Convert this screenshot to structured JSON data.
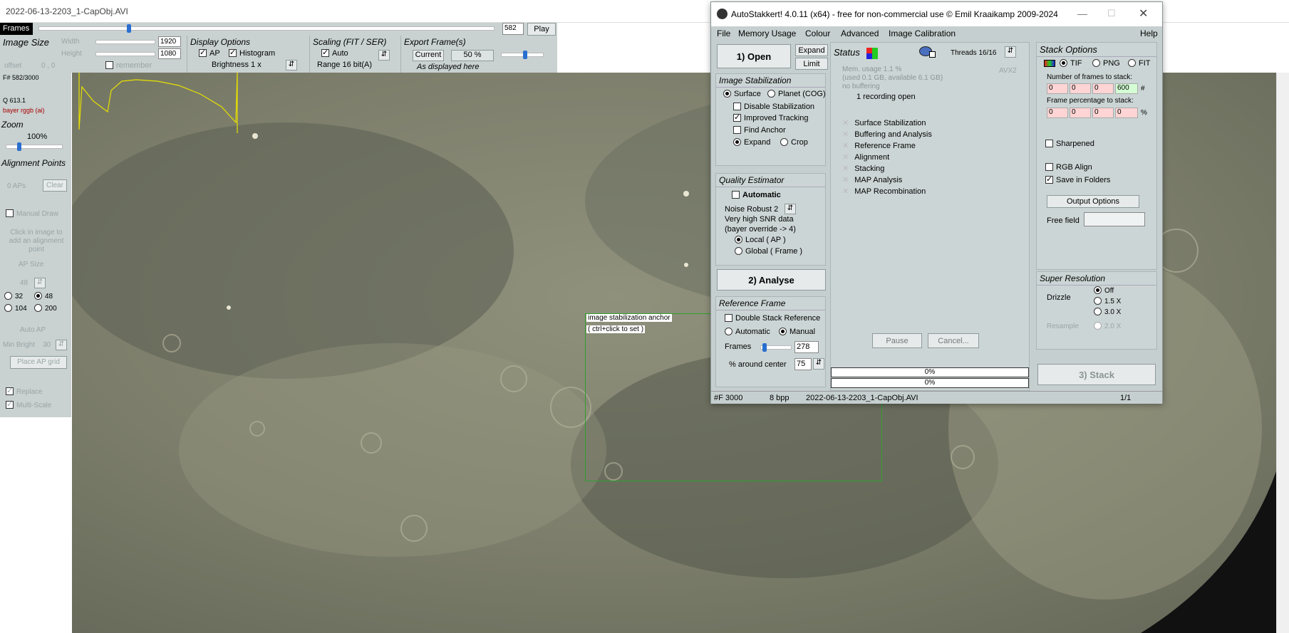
{
  "image_window": {
    "title": "2022-06-13-2203_1-CapObj.AVI",
    "frames_label": "Frames",
    "frame_value": "582",
    "play_label": "Play",
    "frame_position": 0.194
  },
  "image_size": {
    "title": "Image Size",
    "width_label": "Width",
    "width_value": "1920",
    "height_label": "Height",
    "height_value": "1080",
    "offset_label": "offset",
    "offset_value": "0 , 0",
    "remember_label": "remember"
  },
  "display_options": {
    "title": "Display Options",
    "ap_label": "AP",
    "histogram_label": "Histogram",
    "brightness_label": "Brightness 1 x"
  },
  "scaling": {
    "title": "Scaling (FIT / SER)",
    "auto_label": "Auto",
    "range_label": "Range 16 bit(A)"
  },
  "export": {
    "title": "Export Frame(s)",
    "current_label": "Current",
    "percent_value": "50 %",
    "as_displayed": "As displayed here"
  },
  "left_panel": {
    "frame_info": "F# 582/3000",
    "q_info": "Q  613.1",
    "bayer_info": "bayer rggb (ai)",
    "zoom_title": "Zoom",
    "zoom_value": "100%",
    "ap_title": "Alignment Points",
    "aps_label": "0 APs",
    "clear_label": "Clear",
    "manual_draw": "Manual Draw",
    "hint": "Click in image to add an alignment point",
    "ap_size_label": "AP Size",
    "ap_size_value": "48",
    "sizes": [
      "32",
      "48",
      "104",
      "200"
    ],
    "auto_ap_label": "Auto AP",
    "min_bright_label": "Min Bright",
    "min_bright_value": "30",
    "place_grid_label": "Place AP grid",
    "replace_label": "Replace",
    "multiscale_label": "Multi-Scale"
  },
  "anchor": {
    "line1": "image stabilization anchor",
    "line2": "( ctrl+click to set )"
  },
  "autostakkert": {
    "title": "AutoStakkert! 4.0.11 (x64) - free for non-commercial use © Emil Kraaikamp 2009-2024",
    "menu": [
      "File",
      "Memory Usage",
      "Colour",
      "Advanced",
      "Image Calibration",
      "Help"
    ],
    "open_label": "1) Open",
    "expand_label": "Expand",
    "limit_label": "Limit",
    "image_stab": {
      "title": "Image Stabilization",
      "surface": "Surface",
      "planet": "Planet (COG)",
      "disable": "Disable Stabilization",
      "improved": "Improved Tracking",
      "find_anchor": "Find Anchor",
      "expand": "Expand",
      "crop": "Crop"
    },
    "quality": {
      "title": "Quality Estimator",
      "automatic": "Automatic",
      "noise_label": "Noise Robust  2",
      "snr1": "Very high SNR data",
      "snr2": "(bayer override -> 4)",
      "local": "Local     ( AP )",
      "global": "Global    ( Frame )"
    },
    "analyse_label": "2) Analyse",
    "reference": {
      "title": "Reference Frame",
      "double": "Double Stack Reference",
      "automatic": "Automatic",
      "manual": "Manual",
      "frames_label": "Frames",
      "frames_value": "278",
      "around_label": "% around center",
      "around_value": "75"
    },
    "status": {
      "title": "Status",
      "threads": "Threads 16/16",
      "avx": "AVX2",
      "mem1": "Mem. usage 1.1 %",
      "mem2": "(used 0.1 GB, available 6.1 GB)",
      "mem3": "no buffering",
      "recording": "1 recording open",
      "steps": [
        "Surface Stabilization",
        "Buffering and Analysis",
        "Reference Frame",
        "Alignment",
        "Stacking",
        "MAP Analysis",
        "MAP Recombination"
      ],
      "pause_label": "Pause",
      "cancel_label": "Cancel...",
      "progress1": "0%",
      "progress2": "0%"
    },
    "stack_options": {
      "title": "Stack Options",
      "tif": "TIF",
      "png": "PNG",
      "fit": "FIT",
      "frames_to_stack_label": "Number of frames to stack:",
      "frames_values": [
        "0",
        "0",
        "0",
        "600"
      ],
      "hash": "#",
      "pct_label": "Frame percentage to stack:",
      "pct_values": [
        "0",
        "0",
        "0",
        "0"
      ],
      "pct_sign": "%",
      "sharpened": "Sharpened",
      "rgb_align": "RGB Align",
      "save_folders": "Save in Folders",
      "output_options": "Output Options",
      "free_field": "Free field"
    },
    "super_res": {
      "title": "Super Resolution",
      "drizzle": "Drizzle",
      "options": [
        "Off",
        "1.5 X",
        "3.0 X",
        "2.0 X"
      ],
      "resample": "Resample"
    },
    "stack_label": "3) Stack",
    "statusbar": {
      "frames": "#F 3000",
      "bpp": "8 bpp",
      "file": "2022-06-13-2203_1-CapObj.AVI",
      "page": "1/1"
    }
  }
}
